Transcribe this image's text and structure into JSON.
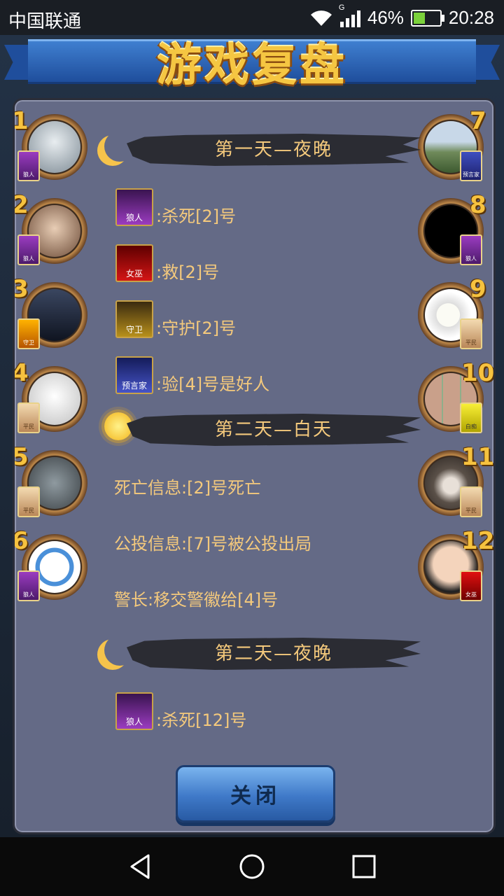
{
  "status_bar": {
    "carrier": "中国联通",
    "network_type": "G",
    "battery": "46%",
    "time": "20:28"
  },
  "header": {
    "title": "游戏复盘"
  },
  "players_left": [
    {
      "number": "1",
      "role_badge": "狼人",
      "role_type": "wolf"
    },
    {
      "number": "2",
      "role_badge": "狼人",
      "role_type": "wolf"
    },
    {
      "number": "3",
      "role_badge": "守卫",
      "role_type": "guard"
    },
    {
      "number": "4",
      "role_badge": "平民",
      "role_type": "villager"
    },
    {
      "number": "5",
      "role_badge": "平民",
      "role_type": "villager"
    },
    {
      "number": "6",
      "role_badge": "狼人",
      "role_type": "wolf"
    }
  ],
  "players_right": [
    {
      "number": "7",
      "role_badge": "预言家",
      "role_type": "seer"
    },
    {
      "number": "8",
      "role_badge": "狼人",
      "role_type": "wolf"
    },
    {
      "number": "9",
      "role_badge": "平民",
      "role_type": "villager"
    },
    {
      "number": "10",
      "role_badge": "白痴",
      "role_type": "idiot"
    },
    {
      "number": "11",
      "role_badge": "平民",
      "role_type": "villager"
    },
    {
      "number": "12",
      "role_badge": "女巫",
      "role_type": "witch"
    }
  ],
  "log": {
    "day1_night": {
      "header": "第一天—夜晚",
      "wolf": {
        "card": "狼人",
        "text": ":杀死[2]号"
      },
      "witch": {
        "card": "女巫",
        "text": ":救[2]号"
      },
      "guard": {
        "card": "守卫",
        "text": ":守护[2]号"
      },
      "seer": {
        "card": "预言家",
        "text": ":验[4]号是好人"
      }
    },
    "day2_day": {
      "header": "第二天—白天",
      "death_info": "死亡信息:[2]号死亡",
      "vote_info": "公投信息:[7]号被公投出局",
      "sheriff_info": "警长:移交警徽给[4]号"
    },
    "day2_night": {
      "header": "第二天—夜晚",
      "wolf": {
        "card": "狼人",
        "text": ":杀死[12]号"
      }
    }
  },
  "close_button": "关闭",
  "nav": {
    "back": "back-icon",
    "home": "home-icon",
    "recent": "recent-apps-icon"
  }
}
